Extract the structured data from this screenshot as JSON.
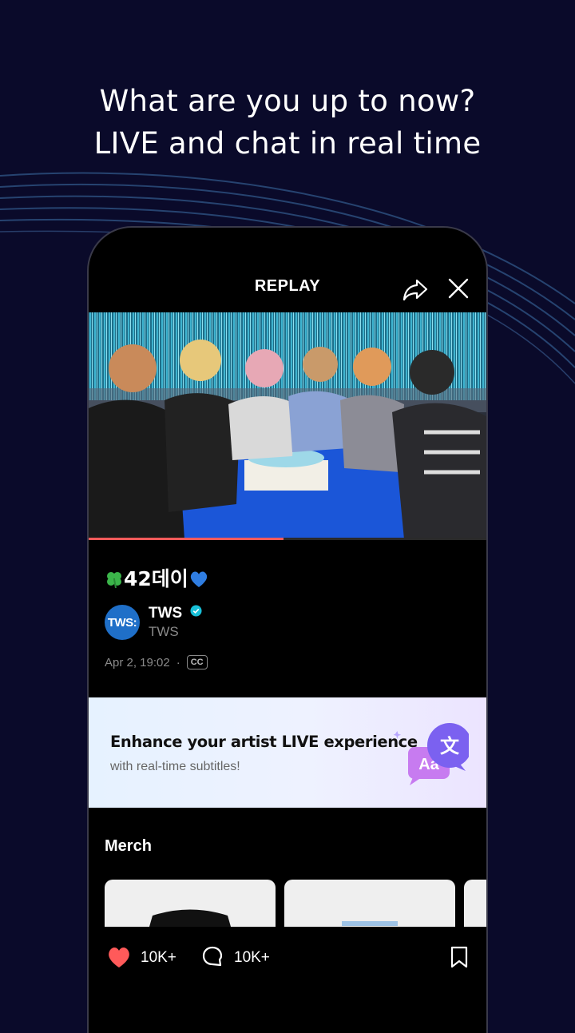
{
  "headline": {
    "line1": "What are you up to now?",
    "line2": "LIVE and chat in real time"
  },
  "player": {
    "header_title": "REPLAY",
    "progress_fraction": 0.49,
    "progress_color": "#ff5a5a"
  },
  "live": {
    "title": "42데이",
    "date": "Apr 2, 19:02",
    "dot": "·",
    "cc_label": "CC"
  },
  "artist": {
    "avatar_text": "TWS:",
    "name": "TWS",
    "sub": "TWS",
    "verified": true
  },
  "banner": {
    "title": "Enhance your artist LIVE experience",
    "subtitle": "with real-time subtitles!",
    "icon_glyph_front": "Aa",
    "icon_glyph_back": "文"
  },
  "merch": {
    "title": "Merch"
  },
  "actions": {
    "like_count": "10K+",
    "comment_count": "10K+"
  },
  "colors": {
    "background": "#0a0a2a",
    "accent_like": "#ff5a5a",
    "avatar_bg": "#1f6fc8",
    "verified": "#18c0d8"
  },
  "icons": [
    "share-icon",
    "close-icon",
    "clover-emoji",
    "blue-heart-emoji",
    "verified-icon",
    "translate-icon",
    "heart-icon",
    "comment-icon",
    "bookmark-icon"
  ]
}
